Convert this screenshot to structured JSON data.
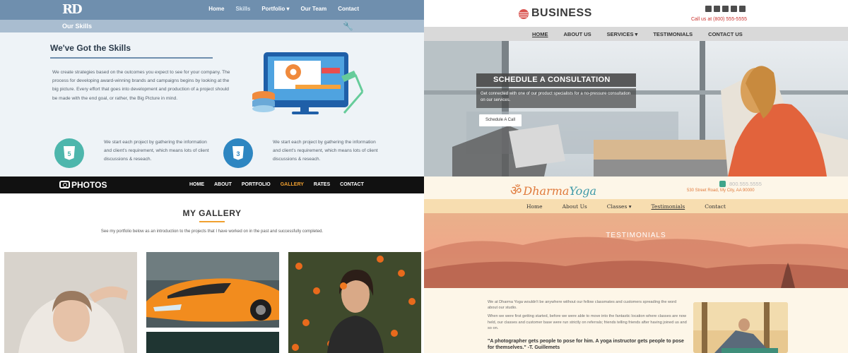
{
  "rd_site": {
    "logo": "RD",
    "menu": [
      "Home",
      "Skills",
      "Portfolio ▾",
      "Our Team",
      "Contact"
    ],
    "active_menu": "Skills",
    "subheader": "Our Skills",
    "heading": "We've Got the Skills",
    "paragraph": "We create strategies based on the outcomes you expect to see for your company. The process for developing award-winning brands and campaigns begins by looking at the big picture. Every effort that goes into development and production of a project should be made with the end goal, or rather, the Big Picture in mind.",
    "feature_1": "We start each project by gathering the information and client's requirement, which means lots of client discussions & reseach.",
    "feature_2": "We start each project by gathering the information and client's requirement, which means lots of client discussions & reseach.",
    "colors": {
      "nav": "#6f8fae",
      "html5": "#4db6ac",
      "css3": "#2e86c1"
    }
  },
  "business_site": {
    "logo": "BUSINESS",
    "phone": "Call us at (800) 555-5555",
    "menu": [
      "HOME",
      "ABOUT US",
      "SERVICES ▾",
      "TESTIMONIALS",
      "CONTACT US"
    ],
    "active_menu": "HOME",
    "cta_title": "SCHEDULE A CONSULTATION",
    "cta_text": "Get connected with one of our product specialists for a no-pressure consultation on our services.",
    "cta_button": "Schedule A Call"
  },
  "photos_site": {
    "logo": "PHOTOS",
    "menu": [
      "HOME",
      "ABOUT",
      "PORTFOLIO",
      "GALLERY",
      "RATES",
      "CONTACT"
    ],
    "active_menu": "GALLERY",
    "title": "MY GALLERY",
    "description": "See my portfolio below as an introduction to the projects that I have worked on in the past and successfully completed.",
    "accent": "#f0a030"
  },
  "yoga_site": {
    "logo_om": "ॐ",
    "logo_a": "Dharma",
    "logo_b": "Yoga",
    "phone": "800.555.5555",
    "address": "530 Street Road, My City, AA 90000",
    "menu": [
      "Home",
      "About Us",
      "Classes ▾",
      "Testimonials",
      "Contact"
    ],
    "active_menu": "Testimonials",
    "banner_title": "TESTIMONIALS",
    "para_1": "We at Dharma Yoga wouldn't be anywhere without our fellow classmates and customers spreading the word about our studio.",
    "para_2": "When we were first getting started, before we were able to move into the fantastic location where classes are now held, our classes and customer base were run strictly on referrals; friends telling friends after having joined us and so on.",
    "quote": "\"A photographer gets people to pose for him. A yoga instructor gets people to pose for themselves.\" -T. Guillemets"
  }
}
